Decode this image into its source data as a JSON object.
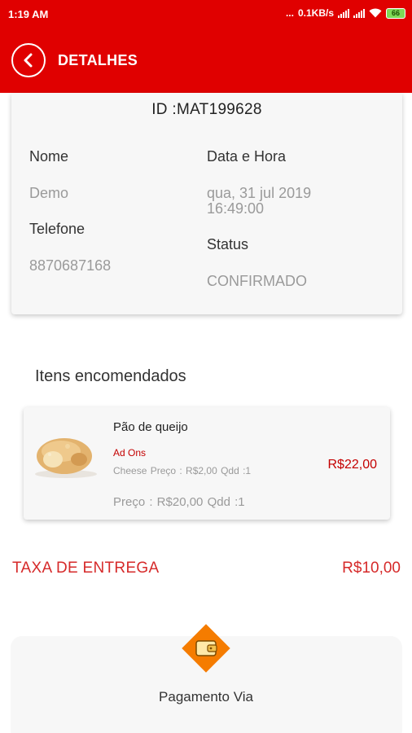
{
  "status_bar": {
    "time": "1:19 AM",
    "dots": "...",
    "speed": "0.1KB/s",
    "battery": "66"
  },
  "header": {
    "title": "DETALHES",
    "back_icon": "back-arrow-circle-icon",
    "color": "#e00000"
  },
  "order": {
    "id": "ID :MAT199628",
    "name_label": "Nome",
    "name_value": "Demo",
    "phone_label": "Telefone",
    "phone_value": "8870687168",
    "datetime_label": "Data e Hora",
    "datetime_line1": "qua, 31 jul 2019",
    "datetime_line2": "16:49:00",
    "status_label": "Status",
    "status_value": "CONFIRMADO"
  },
  "items_title": "Itens encomendados",
  "items": [
    {
      "name": "Pão de queijo",
      "image_icon": "cheese-bread-image",
      "addons_label": "Ad Ons",
      "addon_line": "Cheese Preço : R$2,00  Qdd :1",
      "total": "R$22,00",
      "price_line": "Preço : R$20,00   Qdd :1"
    }
  ],
  "delivery": {
    "label": "TAXA DE ENTREGA",
    "value": "R$10,00"
  },
  "payment": {
    "title": "Pagamento Via",
    "icon": "wallet-icon",
    "accent": "#f57c00"
  }
}
